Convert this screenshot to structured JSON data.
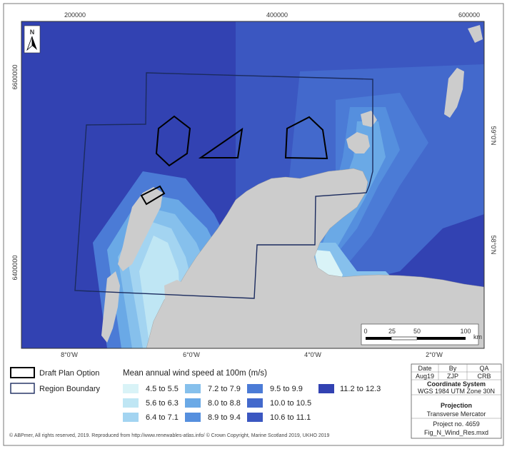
{
  "map": {
    "top_ticks": [
      "200000",
      "400000",
      "600000"
    ],
    "left_ticks": [
      "6600000",
      "6400000"
    ],
    "bottom_ticks": [
      "8°0'W",
      "6°0'W",
      "4°0'W",
      "2°0'W"
    ],
    "right_ticks": [
      "59°0'N",
      "58°0'N"
    ],
    "north_label": "N",
    "scale_labels": [
      "0",
      "25",
      "50",
      "100"
    ],
    "scale_unit": "km"
  },
  "colors": {
    "c1": "#d9f3f7",
    "c2": "#bfe6f4",
    "c3": "#a3d4f1",
    "c4": "#86c0ec",
    "c5": "#6aa9e6",
    "c6": "#558fde",
    "c7": "#4b7bd6",
    "c8": "#4369cc",
    "c9": "#3b57c1",
    "c10": "#3242b2",
    "land": "#cccccc",
    "boundary": "#1b2b5e"
  },
  "legend": {
    "draft_plan": "Draft Plan Option",
    "region_boundary": "Region Boundary",
    "wind_title": "Mean annual wind speed at 100m (m/s)",
    "classes": [
      {
        "label": "4.5 to 5.5",
        "color": "#d9f3f7"
      },
      {
        "label": "5.6 to 6.3",
        "color": "#bfe6f4"
      },
      {
        "label": "6.4 to 7.1",
        "color": "#a3d4f1"
      },
      {
        "label": "7.2 to 7.9",
        "color": "#86c0ec"
      },
      {
        "label": "8.0 to 8.8",
        "color": "#6aa9e6"
      },
      {
        "label": "8.9 to 9.4",
        "color": "#558fde"
      },
      {
        "label": "9.5 to 9.9",
        "color": "#4b7bd6"
      },
      {
        "label": "10.0 to 10.5",
        "color": "#4369cc"
      },
      {
        "label": "10.6 to 11.1",
        "color": "#3b57c1"
      },
      {
        "label": "11.2 to 12.3",
        "color": "#3242b2"
      }
    ]
  },
  "info": {
    "date_h": "Date",
    "by_h": "By",
    "qa_h": "QA",
    "date": "Aug19",
    "by": "ZJP",
    "qa": "CRB",
    "coord_h": "Coordinate System",
    "coord": "WGS 1984 UTM Zone 30N",
    "proj_h": "Projection",
    "proj": "Transverse Mercator",
    "project_no": "Project no. 4659",
    "file": "Fig_N_Wind_Res.mxd"
  },
  "copyright": "© ABPmer, All rights reserved, 2019. Reproduced from http://www.renewables-atlas.info/ © Crown Copyright, Marine Scotland 2019, UKHO 2019"
}
